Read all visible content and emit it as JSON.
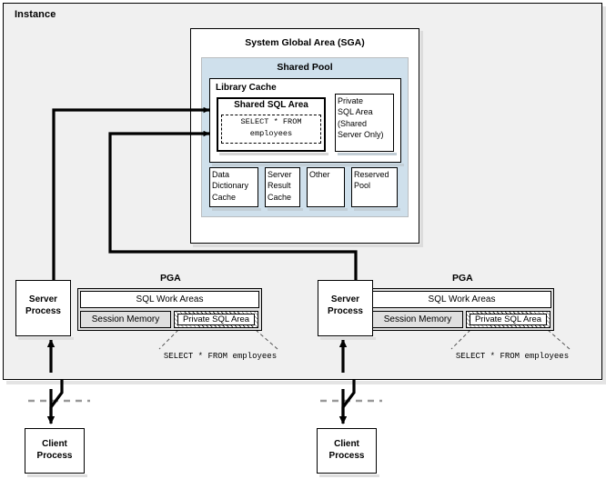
{
  "diagram": {
    "title": "Instance",
    "instance": {
      "label": "Instance"
    },
    "sga": {
      "title": "System Global Area (SGA)",
      "shared_pool": {
        "title": "Shared Pool",
        "library_cache": {
          "title": "Library Cache",
          "shared_sql_area": {
            "title": "Shared SQL Area",
            "sql_line1": "SELECT * FROM",
            "sql_line2": "employees"
          },
          "private_sql_area": {
            "line1": "Private",
            "line2": "SQL Area",
            "line3": "(Shared",
            "line4": "Server Only)"
          }
        },
        "components": [
          {
            "name": "data-dictionary-cache",
            "line1": "Data",
            "line2": "Dictionary",
            "line3": "Cache"
          },
          {
            "name": "server-result-cache",
            "line1": "Server",
            "line2": "Result",
            "line3": "Cache"
          },
          {
            "name": "other",
            "line1": "Other",
            "line2": "",
            "line3": ""
          },
          {
            "name": "reserved-pool",
            "line1": "Reserved",
            "line2": "Pool",
            "line3": ""
          }
        ]
      }
    },
    "processes": [
      {
        "id": "left",
        "server_process": {
          "line1": "Server",
          "line2": "Process"
        },
        "pga": {
          "title": "PGA",
          "sql_work_areas": "SQL Work Areas",
          "session_memory": "Session Memory",
          "private_sql_area": "Private SQL Area",
          "callout_sql": "SELECT * FROM employees"
        },
        "client_process": {
          "line1": "Client",
          "line2": "Process"
        }
      },
      {
        "id": "right",
        "server_process": {
          "line1": "Server",
          "line2": "Process"
        },
        "pga": {
          "title": "PGA",
          "sql_work_areas": "SQL Work Areas",
          "session_memory": "Session Memory",
          "private_sql_area": "Private SQL Area",
          "callout_sql": "SELECT * FROM employees"
        },
        "client_process": {
          "line1": "Client",
          "line2": "Process"
        }
      }
    ],
    "colors": {
      "instance_background": "#f0f0f0",
      "shared_pool_fill": "#cfe0ec",
      "pga_fill": "#e0e0e0",
      "box_stroke": "#000000",
      "page_background": "#ffffff"
    }
  }
}
